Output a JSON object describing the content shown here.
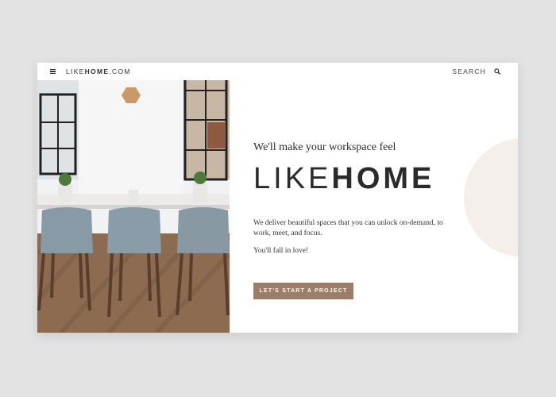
{
  "header": {
    "logo_prefix": "LIKE",
    "logo_bold": "HOME",
    "logo_suffix": ".COM",
    "search_label": "SEARCH",
    "menu_icon": "hamburger-menu-icon",
    "search_icon": "magnifier-icon"
  },
  "hero": {
    "image": "dining-table-with-grey-chairs"
  },
  "content": {
    "tagline": "We'll make your workspace feel",
    "brand_light": "LIKE",
    "brand_bold": "HOME",
    "description": "We deliver beautiful spaces that you can unlock on-demand, to work, meet, and focus.",
    "love_line": "You'll fall in love!",
    "cta_label": "LET'S START A PROJECT"
  },
  "colors": {
    "accent": "#9b7e69",
    "text": "#2b2b2b",
    "background": "#e3e3e3",
    "circle": "#f4efeb"
  }
}
